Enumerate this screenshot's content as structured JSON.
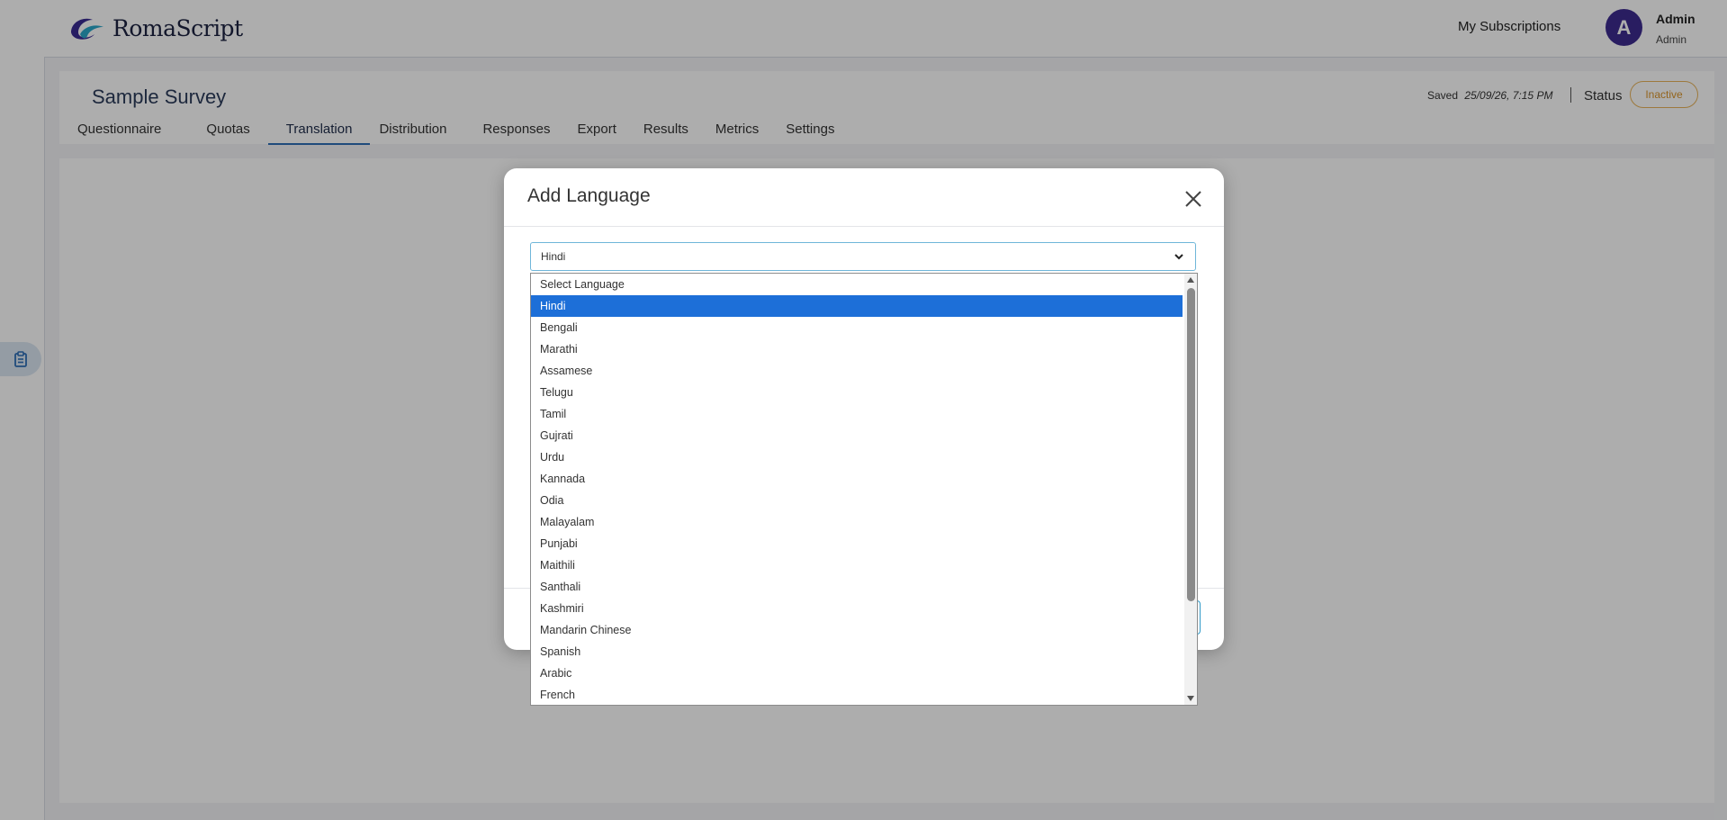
{
  "app": {
    "name": "RomaScript"
  },
  "header": {
    "subscriptions_label": "My Subscriptions",
    "avatar_initial": "A",
    "user_name": "Admin",
    "user_role": "Admin"
  },
  "survey": {
    "title": "Sample Survey",
    "saved_label": "Saved",
    "saved_time": "25/09/26, 7:15 PM",
    "status_label": "Status",
    "status_value": "Inactive",
    "status_color": "#d9942a",
    "tabs": [
      {
        "label": "Questionnaire"
      },
      {
        "label": "Quotas"
      },
      {
        "label": "Translation",
        "active": true
      },
      {
        "label": "Distribution"
      },
      {
        "label": "Responses"
      },
      {
        "label": "Export"
      },
      {
        "label": "Results"
      },
      {
        "label": "Metrics"
      },
      {
        "label": "Settings"
      }
    ]
  },
  "modal": {
    "title": "Add Language",
    "select_value": "Hindi",
    "options": [
      "Select Language",
      "Hindi",
      "Bengali",
      "Marathi",
      "Assamese",
      "Telugu",
      "Tamil",
      "Gujrati",
      "Urdu",
      "Kannada",
      "Odia",
      "Malayalam",
      "Punjabi",
      "Maithili",
      "Santhali",
      "Kashmiri",
      "Mandarin Chinese",
      "Spanish",
      "Arabic",
      "French"
    ],
    "selected_option": "Hindi"
  },
  "colors": {
    "accent": "#2f6fb7",
    "selected_option": "#1d6fd8",
    "avatar": "#3d2b8f"
  }
}
